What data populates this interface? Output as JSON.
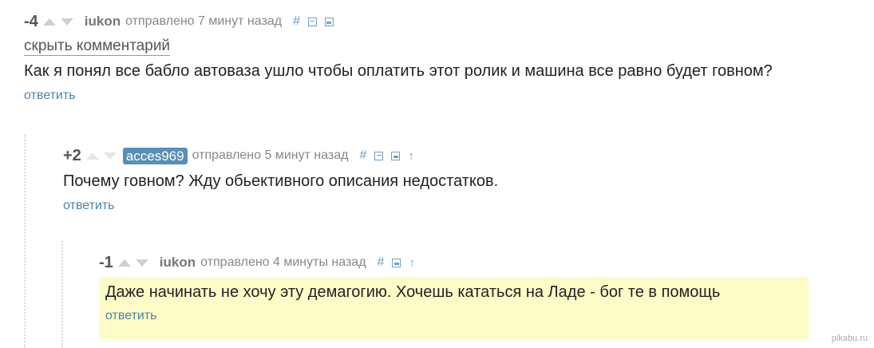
{
  "comments": [
    {
      "rating": "-4",
      "author": "iukon",
      "sent": "отправлено 7 минут назад",
      "hide_label": "скрыть комментарий",
      "text": "Как я понял все бабло автоваза ушло чтобы оплатить этот ролик и машина все равно будет говном?",
      "reply_label": "ответить"
    },
    {
      "rating": "+2",
      "author": "acces969",
      "sent": "отправлено 5 минут назад",
      "text": "Почему говном? Жду обьективного описания недостатков.",
      "reply_label": "ответить"
    },
    {
      "rating": "-1",
      "author": "iukon",
      "sent": "отправлено 4 минуты назад",
      "text": "Даже начинать не хочу эту демагогию. Хочешь кататься на Ладе - бог те в помощь",
      "reply_label": "ответить"
    }
  ],
  "toolbar_glyphs": {
    "link": "#",
    "parent": "↑"
  },
  "icons": [
    "triangle-up-icon",
    "triangle-down-icon",
    "hash-link-icon",
    "collapse-icon",
    "save-icon",
    "arrow-up-icon"
  ],
  "colors": {
    "accent": "#4f83a8",
    "badge": "#5a8fb5",
    "highlight": "#fdfcc8"
  },
  "watermark": "pikabu.ru"
}
